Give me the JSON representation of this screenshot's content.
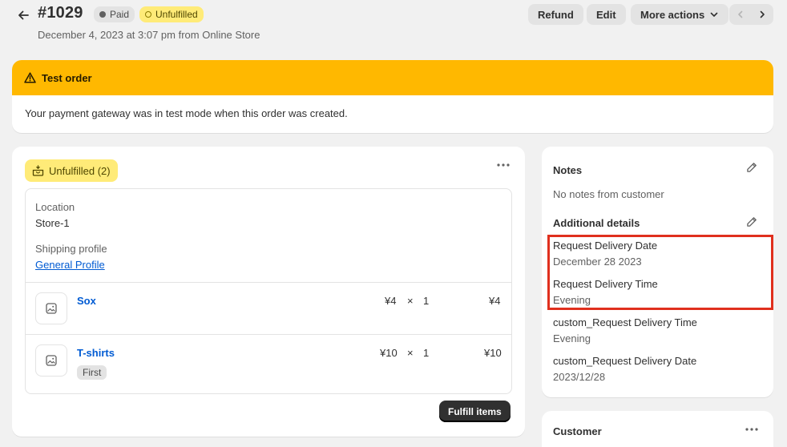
{
  "header": {
    "order_number": "#1029",
    "badge_paid": "Paid",
    "badge_fulfillment": "Unfulfilled",
    "subtitle": "December 4, 2023 at 3:07 pm from Online Store",
    "refund_label": "Refund",
    "edit_label": "Edit",
    "more_actions_label": "More actions"
  },
  "banner": {
    "title": "Test order",
    "message": "Your payment gateway was in test mode when this order was created.",
    "color": "#ffb800"
  },
  "fulfillment": {
    "status_label": "Unfulfilled (2)",
    "location_label": "Location",
    "location_value": "Store-1",
    "shipping_label": "Shipping profile",
    "shipping_value": "General Profile",
    "items": [
      {
        "name": "Sox",
        "price": "¥4",
        "times": "×",
        "qty": "1",
        "total": "¥4",
        "variant": ""
      },
      {
        "name": "T-shirts",
        "price": "¥10",
        "times": "×",
        "qty": "1",
        "total": "¥10",
        "variant": "First"
      }
    ],
    "fulfill_label": "Fulfill items"
  },
  "notes": {
    "title": "Notes",
    "empty_text": "No notes from customer",
    "additional_title": "Additional details",
    "details": [
      {
        "label": "Request Delivery Date",
        "value": "December 28 2023"
      },
      {
        "label": "Request Delivery Time",
        "value": "Evening"
      },
      {
        "label": "custom_Request Delivery Time",
        "value": "Evening"
      },
      {
        "label": "custom_Request Delivery Date",
        "value": "2023/12/28"
      }
    ]
  },
  "customer": {
    "title": "Customer"
  },
  "colors": {
    "accent_link": "#005bd3",
    "highlight": "#e0301e",
    "badge_yellow": "#ffeb78"
  }
}
